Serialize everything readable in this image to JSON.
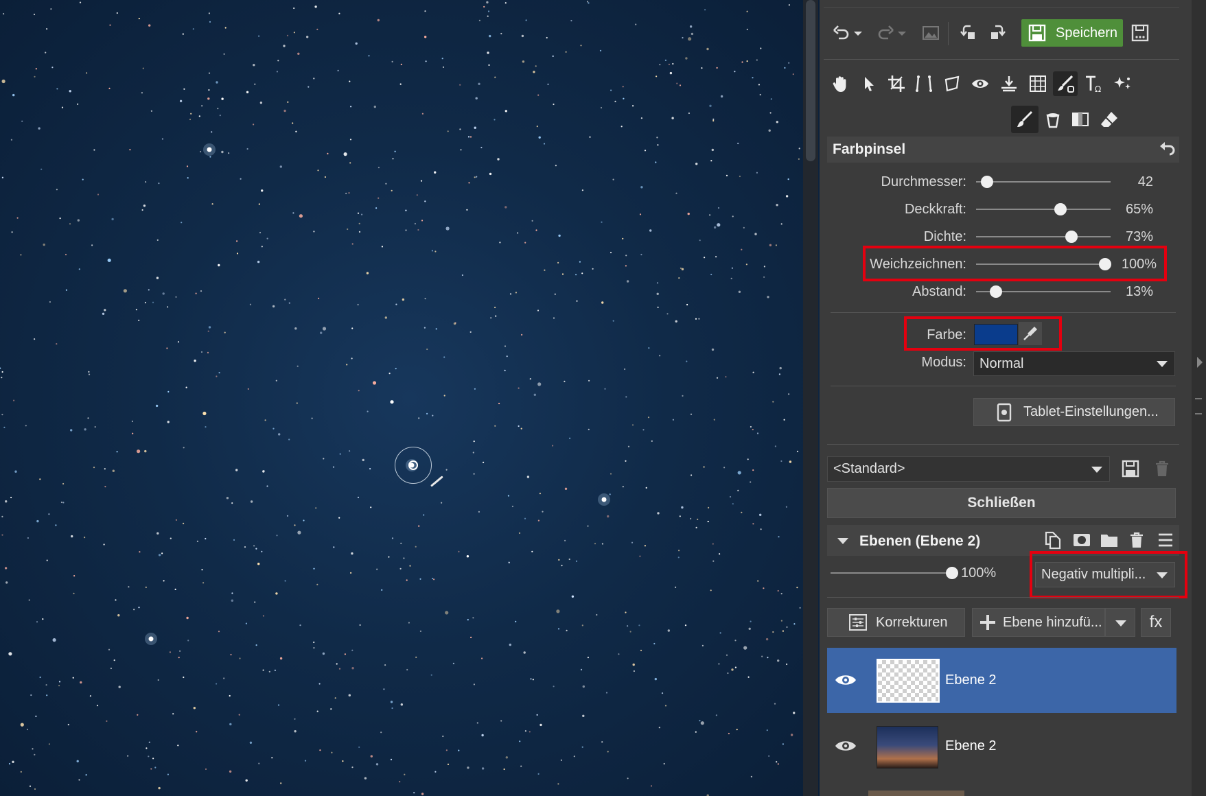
{
  "toolbar": {
    "save_label": "Speichern"
  },
  "tool_panel": {
    "title": "Farbpinsel",
    "sliders": [
      {
        "label": "Durchmesser:",
        "value": "42",
        "fraction": 0.08
      },
      {
        "label": "Deckkraft:",
        "value": "65%",
        "fraction": 0.63
      },
      {
        "label": "Dichte:",
        "value": "73%",
        "fraction": 0.71
      },
      {
        "label": "Weichzeichnen:",
        "value": "100%",
        "fraction": 0.96
      },
      {
        "label": "Abstand:",
        "value": "13%",
        "fraction": 0.15
      }
    ],
    "color_label": "Farbe:",
    "color_value": "#0a3c8c",
    "mode_label": "Modus:",
    "mode_value": "Normal",
    "tablet_button": "Tablet-Einstellungen...",
    "preset_value": "<Standard>",
    "close_button": "Schließen"
  },
  "layers": {
    "title": "Ebenen (Ebene 2)",
    "opacity": "100%",
    "opacity_fraction": 1.0,
    "blend_mode": "Negativ multipli...",
    "corrections_button": "Korrekturen",
    "add_layer_button": "Ebene hinzufü...",
    "fx_button": "fx",
    "items": [
      {
        "name": "Ebene 2",
        "selected": true
      },
      {
        "name": "Ebene 2",
        "selected": false
      }
    ]
  },
  "colors": {
    "accent_green": "#4f8f3a",
    "selection_blue": "#3c66a8",
    "highlight_red": "#e4000f"
  }
}
